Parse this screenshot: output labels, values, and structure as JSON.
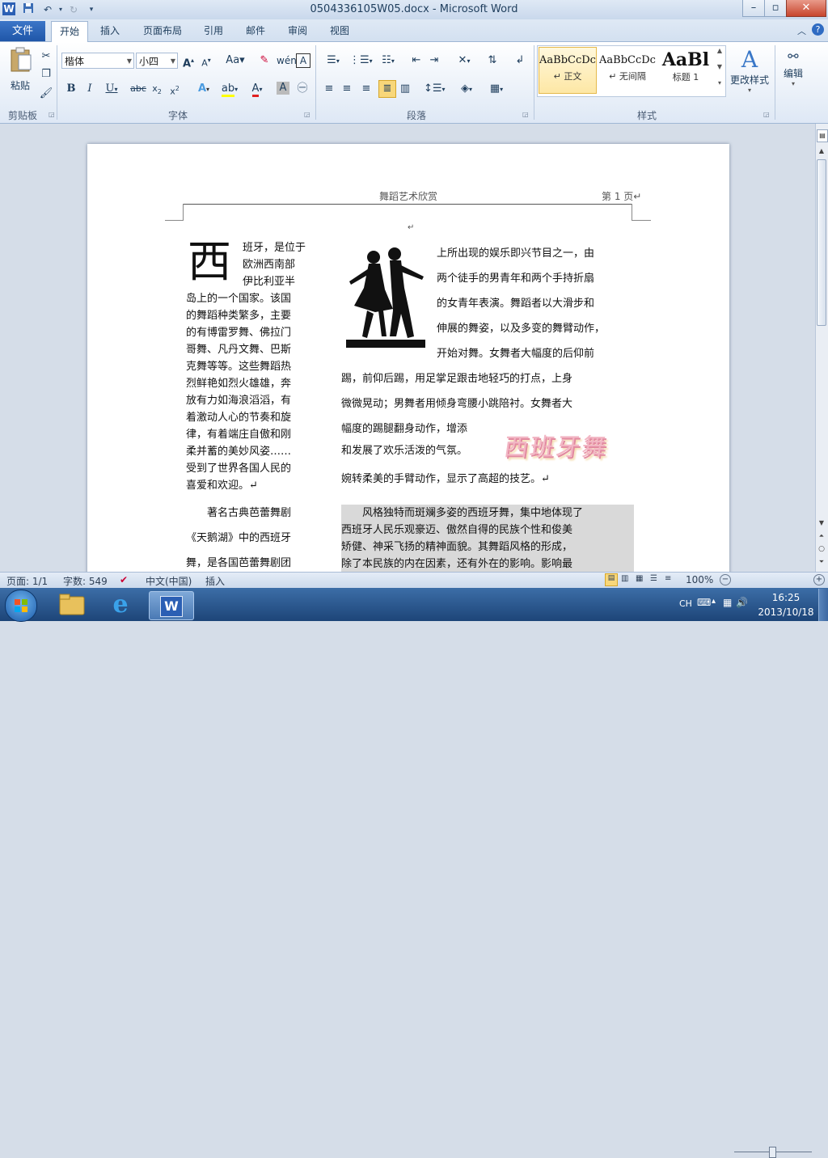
{
  "window": {
    "title": "0504336105W05.docx - Microsoft Word",
    "app_icon": "W"
  },
  "tabs": [
    "文件",
    "开始",
    "插入",
    "页面布局",
    "引用",
    "邮件",
    "审阅",
    "视图"
  ],
  "ribbon": {
    "clipboard": {
      "paste_label": "粘贴",
      "group_label": "剪贴板"
    },
    "font": {
      "font_name": "楷体",
      "font_size": "小四",
      "group_label": "字体"
    },
    "paragraph": {
      "group_label": "段落"
    },
    "styles": {
      "group_label": "样式",
      "items": [
        {
          "sample": "AaBbCcDc",
          "name": "↵ 正文"
        },
        {
          "sample": "AaBbCcDc",
          "name": "↵ 无间隔"
        },
        {
          "sample": "AaBl",
          "name": "标题 1"
        }
      ],
      "change_styles": "更改样式"
    },
    "editing": {
      "label": "编辑"
    }
  },
  "document": {
    "header_center": "舞蹈艺术欣赏",
    "header_right": "第 1 页↵",
    "para_mark": "↵",
    "drop_cap": "西",
    "left_col": {
      "first_lines": [
        "班牙，是位于",
        "欧洲西南部",
        "伊比利亚半"
      ],
      "rest_lines": [
        "岛上的一个国家。该国",
        "的舞蹈种类繁多，主要",
        "的有博雷罗舞、佛拉门",
        "哥舞、凡丹文舞、巴斯",
        "克舞等等。这些舞蹈热",
        "烈鲜艳如烈火雄雄，奔",
        "放有力如海浪滔滔，有",
        "着激动人心的节奏和旋",
        "律，有着端庄自傲和刚",
        "柔并蓄的美妙风姿……",
        "受到了世界各国人民的",
        "喜爱和欢迎。↵"
      ],
      "para2_lines": [
        "　　著名古典芭蕾舞剧",
        "《天鹅湖》中的西班牙",
        "舞，是各国芭蕾舞剧团"
      ]
    },
    "right_col": {
      "wrap_lines": [
        "上所出现的娱乐即兴节目之一，由",
        "两个徒手的男青年和两个手持折扇",
        "的女青年表演。舞蹈者以大滑步和",
        "伸展的舞姿，以及多变的舞臂动作，",
        "开始对舞。女舞者大幅度的后仰前"
      ],
      "full_lines": [
        "踢，前仰后踢，用足掌足跟击地轻巧的打点，上身",
        "微微晃动；男舞者用倾身弯腰小跳陪衬。女舞者大",
        "幅度的踢腿翻身动作，增添"
      ],
      "line_before_art": "和发展了欢乐活泼的气氛。",
      "last_line": "婉转柔美的手臂动作，显示了高超的技艺。↵",
      "shaded_lines": [
        "　　风格独特而斑斓多姿的西班牙舞，集中地体现了",
        "西班牙人民乐观豪迈、傲然自得的民族个性和俊美",
        "矫健、神采飞扬的精神面貌。其舞蹈风格的形成，",
        "除了本民族的内在因素，还有外在的影响。影响最"
      ]
    },
    "wordart": "西班牙舞"
  },
  "status": {
    "page": "页面: 1/1",
    "words": "字数: 549",
    "language": "中文(中国)",
    "mode": "插入",
    "zoom": "100%"
  },
  "taskbar": {
    "ime": "CH",
    "time": "16:25",
    "date": "2013/10/18"
  },
  "colors": {
    "ribbon_top": "#ffffff",
    "file_tab": "#2a62b4",
    "taskbar": "#2a5a92",
    "shade": "#d9d9d9"
  }
}
